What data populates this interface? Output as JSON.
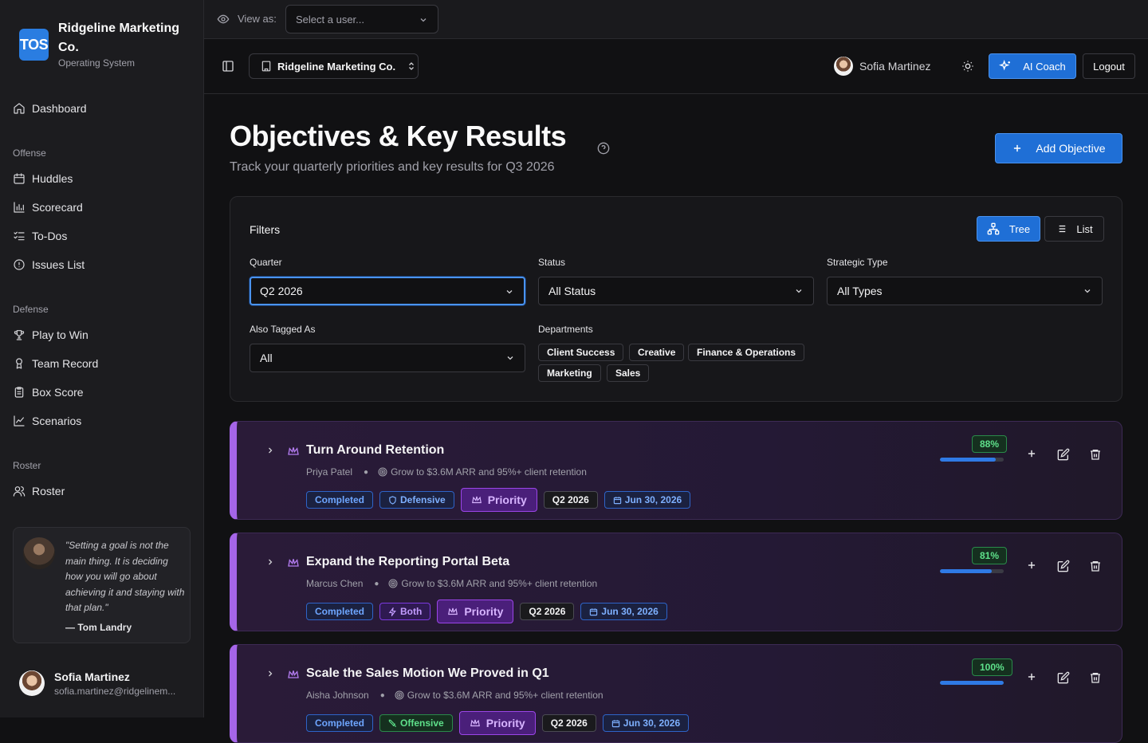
{
  "app": {
    "brand_logo": "TOS",
    "brand_name": "Ridgeline Marketing Co.",
    "brand_sub": "Operating System"
  },
  "sidebar": {
    "dashboard": "Dashboard",
    "sections": {
      "offense": "Offense",
      "defense": "Defense",
      "roster": "Roster"
    },
    "offense_items": [
      "Huddles",
      "Scorecard",
      "To-Dos",
      "Issues List"
    ],
    "defense_items": [
      "Play to Win",
      "Team Record",
      "Box Score",
      "Scenarios"
    ],
    "roster_items": [
      "Roster"
    ]
  },
  "quote": {
    "text": "\"Setting a goal is not the main thing. It is deciding how you will go about achieving it and staying with that plan.\"",
    "author": "— Tom Landry"
  },
  "current_user": {
    "name": "Sofia Martinez",
    "email": "sofia.martinez@ridgelinem..."
  },
  "topbar": {
    "view_as_label": "View as:",
    "user_select_placeholder": "Select a user..."
  },
  "header": {
    "org_name": "Ridgeline Marketing Co.",
    "user_name": "Sofia Martinez",
    "ai_coach": "AI Coach",
    "logout": "Logout"
  },
  "page": {
    "title": "Objectives & Key Results",
    "subtitle": "Track your quarterly priorities and key results for Q3 2026",
    "add_button": "Add Objective"
  },
  "filters": {
    "title": "Filters",
    "view_tree": "Tree",
    "view_list": "List",
    "quarter_label": "Quarter",
    "quarter_value": "Q2 2026",
    "status_label": "Status",
    "status_value": "All Status",
    "type_label": "Strategic Type",
    "type_value": "All Types",
    "tagged_label": "Also Tagged As",
    "tagged_value": "All",
    "departments_label": "Departments",
    "departments": [
      "Client Success",
      "Creative",
      "Finance & Operations",
      "Marketing",
      "Sales"
    ]
  },
  "colors": {
    "accent": "#1f6fd6",
    "priority_purple": "#a565e8",
    "progress_green": "#5ee08a"
  },
  "objectives": [
    {
      "title": "Turn Around Retention",
      "owner": "Priya Patel",
      "parent": "Grow to $3.6M ARR and 95%+ client retention",
      "status": "Completed",
      "type": "Defensive",
      "type_icon": "shield-icon",
      "priority": "Priority",
      "quarter": "Q2 2026",
      "due": "Jun 30, 2026",
      "progress_label": "88%",
      "progress": 0.88
    },
    {
      "title": "Expand the Reporting Portal Beta",
      "owner": "Marcus Chen",
      "parent": "Grow to $3.6M ARR and 95%+ client retention",
      "status": "Completed",
      "type": "Both",
      "type_icon": "bolt-icon",
      "priority": "Priority",
      "quarter": "Q2 2026",
      "due": "Jun 30, 2026",
      "progress_label": "81%",
      "progress": 0.81
    },
    {
      "title": "Scale the Sales Motion We Proved in Q1",
      "owner": "Aisha Johnson",
      "parent": "Grow to $3.6M ARR and 95%+ client retention",
      "status": "Completed",
      "type": "Offensive",
      "type_icon": "swords-icon",
      "priority": "Priority",
      "quarter": "Q2 2026",
      "due": "Jun 30, 2026",
      "progress_label": "100%",
      "progress": 1.0
    }
  ]
}
